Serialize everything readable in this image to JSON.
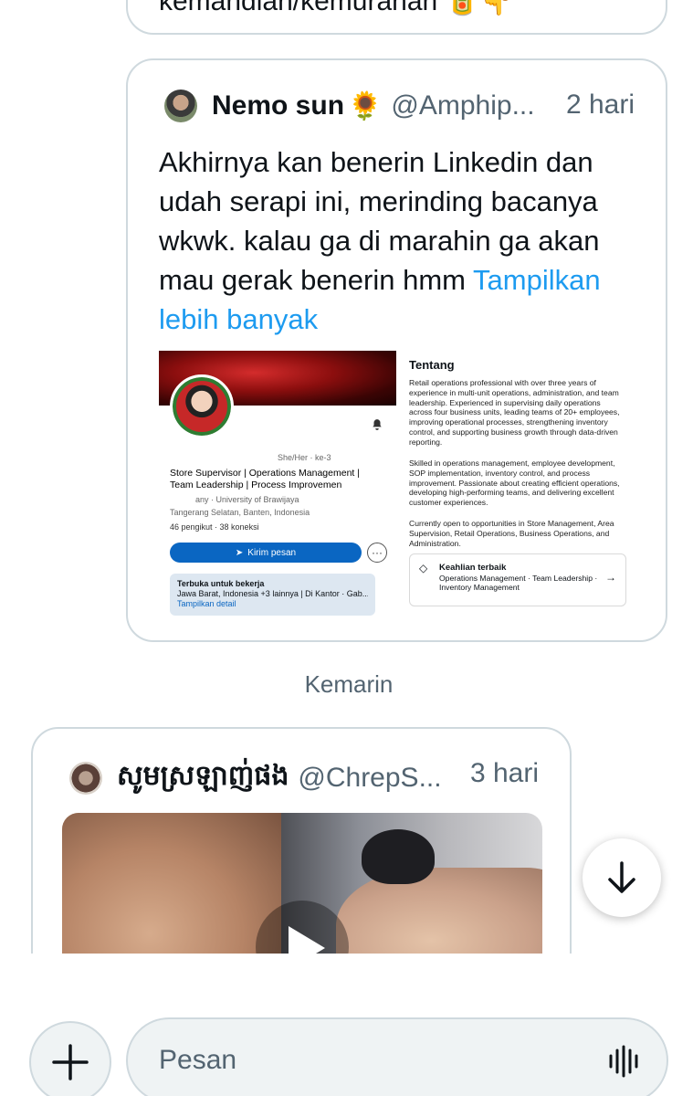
{
  "previous_message": {
    "text": "kemandian/kemurahan 🥫👇"
  },
  "tweet1": {
    "author_name": "Nemo sun",
    "author_emoji": "🌻",
    "handle": "@Amphip...",
    "time": "2 hari",
    "text": "Akhirnya kan benerin Linkedin dan udah serapi ini, merinding bacanya wkwk. kalau ga di marahin ga akan mau gerak benerin hmm ",
    "show_more": "Tampilkan lebih banyak",
    "profile": {
      "photo_badge": "#OPENTOWORK",
      "name_line": "She/Her · ke-3",
      "headline": "Store Supervisor | Operations Management | Team Leadership | Process Improvemen",
      "company": "any · University of Brawijaya",
      "location": "Tangerang Selatan, Banten, Indonesia",
      "stats": "46 pengikut · 38 koneksi",
      "message_button": "Kirim pesan",
      "more": "···",
      "otw_title": "Terbuka untuk bekerja",
      "otw_detail": "Jawa Barat, Indonesia +3 lainnya | Di Kantor · Gab...",
      "otw_link": "Tampilkan detail"
    },
    "about": {
      "title": "Tentang",
      "para1": "Retail operations professional with over three years of experience in multi-unit operations, administration, and team leadership. Experienced in supervising daily operations across four business units, leading teams of 20+ employees, improving operational processes, strengthening inventory control, and supporting business growth through data-driven reporting.",
      "para2": "Skilled in operations management, employee development, SOP implementation, inventory control, and process improvement. Passionate about creating efficient operations, developing high-performing teams, and delivering excellent customer experiences.",
      "para3": "Currently open to opportunities in Store Management, Area Supervision, Retail Operations, Business Operations, and Administration.",
      "skills_title": "Keahlian terbaik",
      "skills": "Operations Management · Team Leadership · Inventory Management"
    }
  },
  "day_separator": "Kemarin",
  "tweet2": {
    "author_name": "សូមស្រឡាញ់ផង",
    "handle": "@ChrepS...",
    "time": "3 hari"
  },
  "composer": {
    "placeholder": "Pesan"
  },
  "icons": {
    "scroll": "arrow-down-icon",
    "add": "plus-icon",
    "voice": "voice-wave-icon",
    "play": "play-icon"
  },
  "colors": {
    "link": "#1d9bf0",
    "secondary_text": "#536471",
    "border": "#cfd9de",
    "linkedin_blue": "#0a66c2"
  }
}
